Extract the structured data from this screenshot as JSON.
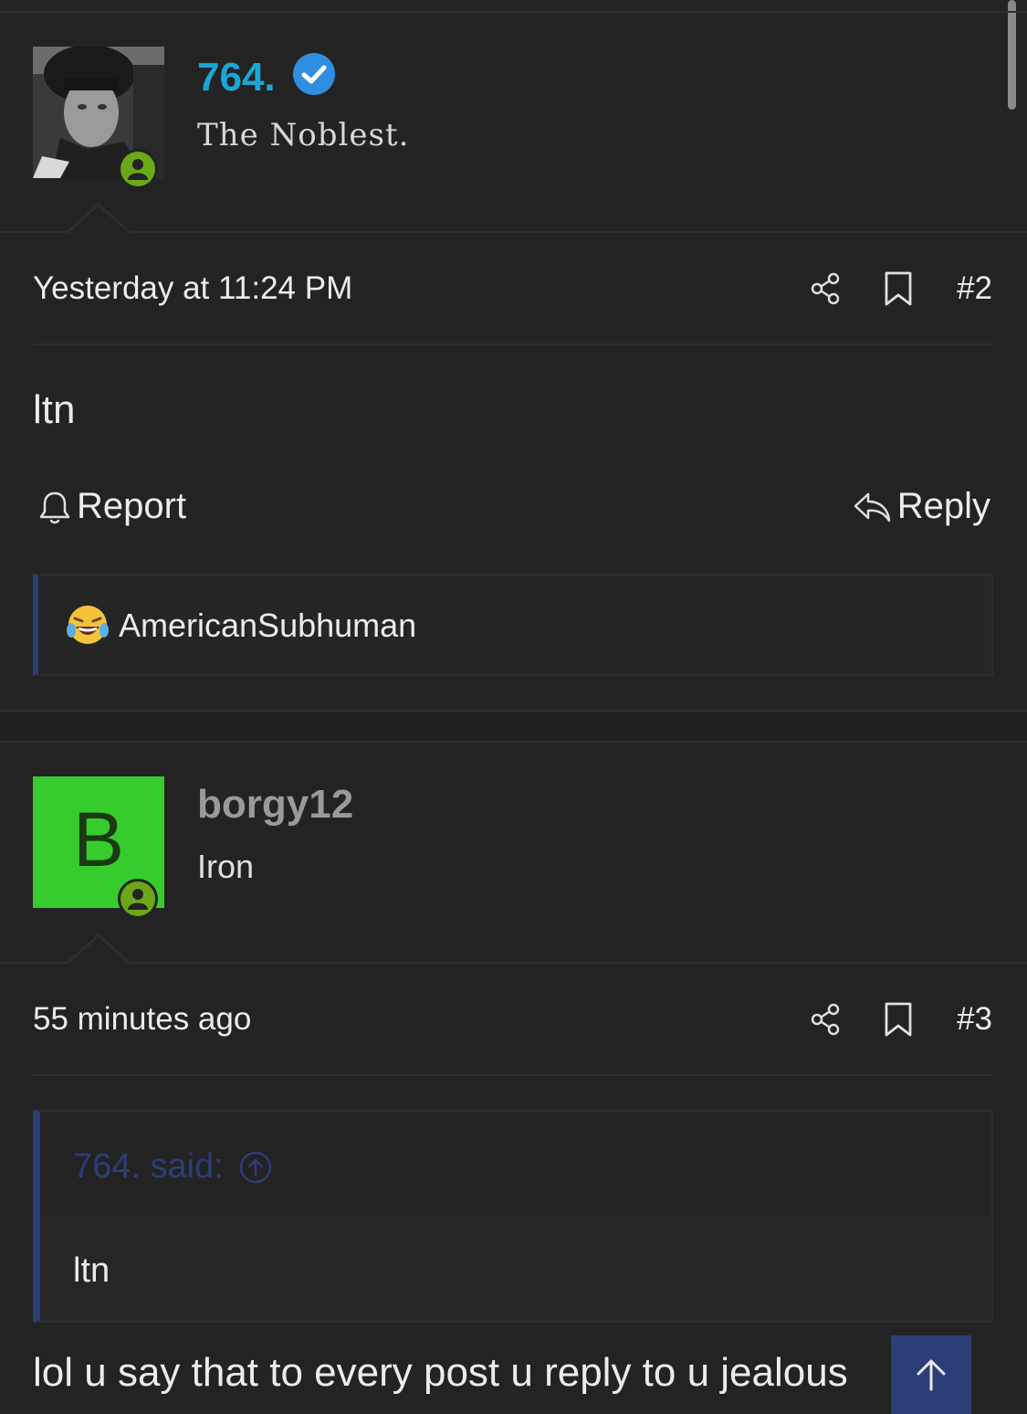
{
  "post2": {
    "username": "764.",
    "user_title": "The Noblest.",
    "timestamp": "Yesterday at 11:24 PM",
    "post_number": "#2",
    "body": "ltn",
    "report_label": "Report",
    "reply_label": "Reply",
    "reaction_user": "AmericanSubhuman"
  },
  "post3": {
    "avatar_letter": "B",
    "username": "borgy12",
    "user_title": "Iron",
    "timestamp": "55 minutes ago",
    "post_number": "#3",
    "quote_attribution": "764. said:",
    "quote_text": "ltn",
    "body": "lol u say that to every post u reply to u jealous"
  },
  "colors": {
    "background": "#232323",
    "username_link": "#1aa6d6",
    "verified_badge": "#2f8ee0",
    "online_status": "#6aa818",
    "letter_avatar": "#36cc2e",
    "quote_accent": "#2c3e78"
  },
  "icons": [
    "verified-icon",
    "online-status-icon",
    "share-icon",
    "bookmark-icon",
    "bell-icon",
    "reply-icon",
    "laughing-emoji-icon",
    "arrow-up-circle-icon",
    "back-to-top-icon"
  ]
}
